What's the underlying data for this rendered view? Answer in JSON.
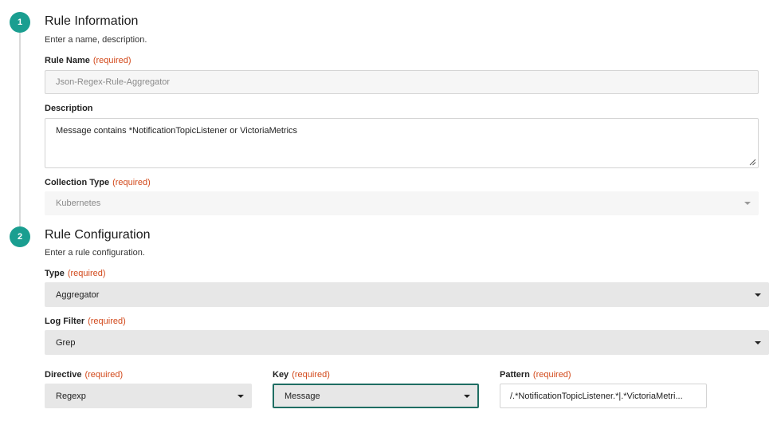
{
  "steps": [
    {
      "number": "1",
      "title": "Rule Information",
      "subtitle": "Enter a name, description."
    },
    {
      "number": "2",
      "title": "Rule Configuration",
      "subtitle": "Enter a rule configuration."
    }
  ],
  "rule_name": {
    "label": "Rule Name",
    "required": "(required)",
    "value": "Json-Regex-Rule-Aggregator"
  },
  "description": {
    "label": "Description",
    "value": "Message contains *NotificationTopicListener or VictoriaMetrics"
  },
  "collection_type": {
    "label": "Collection Type",
    "required": "(required)",
    "value": "Kubernetes"
  },
  "type": {
    "label": "Type",
    "required": "(required)",
    "value": "Aggregator"
  },
  "log_filter": {
    "label": "Log Filter",
    "required": "(required)",
    "value": "Grep"
  },
  "directive": {
    "label": "Directive",
    "required": "(required)",
    "value": "Regexp"
  },
  "key": {
    "label": "Key",
    "required": "(required)",
    "value": "Message"
  },
  "pattern": {
    "label": "Pattern",
    "required": "(required)",
    "value": "/.*NotificationTopicListener.*|.*VictoriaMetri..."
  },
  "colors": {
    "accent": "#1a9e90",
    "required": "#d2491b",
    "focus_border": "#1f6e63"
  },
  "icons": {
    "select_arrow": "caret-down-icon",
    "resize": "resize-handle-icon"
  }
}
